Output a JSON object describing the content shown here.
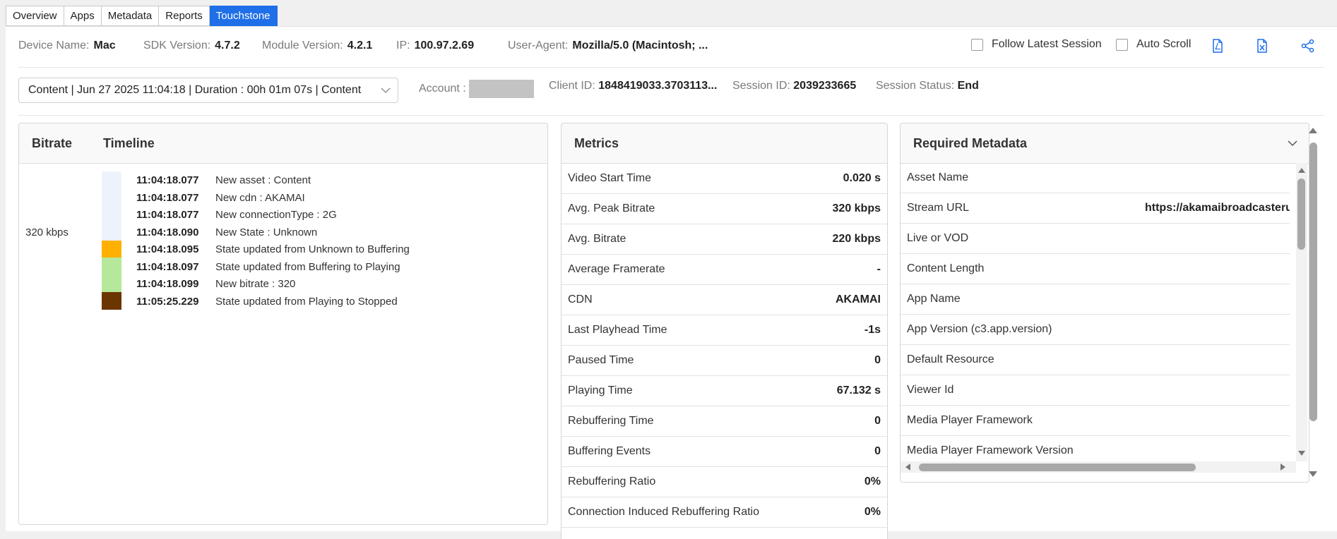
{
  "tabs": [
    "Overview",
    "Apps",
    "Metadata",
    "Reports",
    "Touchstone"
  ],
  "active_tab": "Touchstone",
  "info": [
    {
      "label": "Device Name:",
      "value": "Mac"
    },
    {
      "label": "SDK Version:",
      "value": "4.7.2"
    },
    {
      "label": "Module Version:",
      "value": "4.2.1"
    },
    {
      "label": "IP:",
      "value": "100.97.2.69"
    },
    {
      "label": "User-Agent:",
      "value": "Mozilla/5.0 (Macintosh; ..."
    }
  ],
  "options": {
    "follow_latest": "Follow Latest Session",
    "auto_scroll": "Auto Scroll"
  },
  "session": {
    "selected": "Content | Jun 27 2025 11:04:18 | Duration : 00h 01m 07s | Content",
    "account_label": "Account :",
    "client_id_label": "Client ID:",
    "client_id": "1848419033.3703113...",
    "session_id_label": "Session ID:",
    "session_id": "2039233665",
    "status_label": "Session Status:",
    "status": "End"
  },
  "timeline_panel": {
    "bitrate_header": "Bitrate",
    "timeline_header": "Timeline",
    "bitrate_value": "320 kbps",
    "events": [
      {
        "time": "11:04:18.077",
        "event": "New asset : Content"
      },
      {
        "time": "11:04:18.077",
        "event": "New cdn : AKAMAI"
      },
      {
        "time": "11:04:18.077",
        "event": "New connectionType : 2G"
      },
      {
        "time": "11:04:18.090",
        "event": "New State : Unknown"
      },
      {
        "time": "11:04:18.095",
        "event": "State updated from Unknown to Buffering"
      },
      {
        "time": "11:04:18.097",
        "event": "State updated from Buffering to Playing"
      },
      {
        "time": "11:04:18.099",
        "event": "New bitrate : 320"
      },
      {
        "time": "11:05:25.229",
        "event": "State updated from Playing to Stopped"
      }
    ],
    "state_colors": {
      "unknown": "#eef3fb",
      "buffering": "#ffb000",
      "playing": "#b5e89a",
      "stopped": "#6b3500"
    }
  },
  "metrics_panel": {
    "title": "Metrics",
    "rows": [
      {
        "label": "Video Start Time",
        "value": "0.020 s"
      },
      {
        "label": "Avg. Peak Bitrate",
        "value": "320 kbps"
      },
      {
        "label": "Avg. Bitrate",
        "value": "220 kbps"
      },
      {
        "label": "Average Framerate",
        "value": "-"
      },
      {
        "label": "CDN",
        "value": "AKAMAI"
      },
      {
        "label": "Last Playhead Time",
        "value": "-1s"
      },
      {
        "label": "Paused Time",
        "value": "0"
      },
      {
        "label": "Playing Time",
        "value": "67.132 s"
      },
      {
        "label": "Rebuffering Time",
        "value": "0"
      },
      {
        "label": "Buffering Events",
        "value": "0"
      },
      {
        "label": "Rebuffering Ratio",
        "value": "0%"
      },
      {
        "label": "Connection Induced Rebuffering Ratio",
        "value": "0%"
      }
    ]
  },
  "metadata_panel": {
    "title": "Required Metadata",
    "rows": [
      {
        "label": "Asset Name",
        "value": ""
      },
      {
        "label": "Stream URL",
        "value": "https://akamaibroadcasterus"
      },
      {
        "label": "Live or VOD",
        "value": ""
      },
      {
        "label": "Content Length",
        "value": ""
      },
      {
        "label": "App Name",
        "value": ""
      },
      {
        "label": "App Version (c3.app.version)",
        "value": ""
      },
      {
        "label": "Default Resource",
        "value": ""
      },
      {
        "label": "Viewer Id",
        "value": ""
      },
      {
        "label": "Media Player Framework",
        "value": ""
      },
      {
        "label": "Media Player Framework Version",
        "value": ""
      }
    ]
  },
  "icons": [
    "pdf-export-icon",
    "excel-export-icon",
    "share-icon",
    "chevron-down-icon"
  ],
  "accent_color": "#1f6fe8"
}
